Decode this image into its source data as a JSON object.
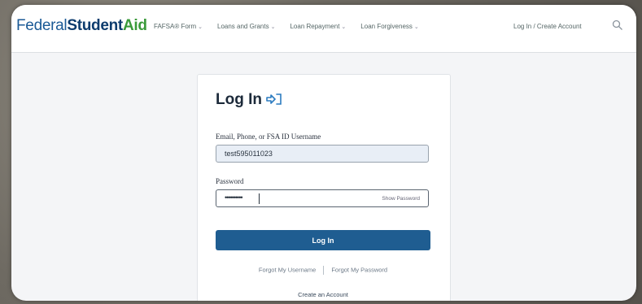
{
  "header": {
    "logo": {
      "part1": "Federal",
      "part2": "Student",
      "part3": "Aid"
    },
    "nav": [
      {
        "label": "FAFSA® Form"
      },
      {
        "label": "Loans and Grants"
      },
      {
        "label": "Loan Repayment"
      },
      {
        "label": "Loan Forgiveness"
      }
    ],
    "auth_link": "Log In / Create Account"
  },
  "login": {
    "title": "Log In",
    "username_label": "Email, Phone, or FSA ID Username",
    "username_value": "test595011023",
    "password_label": "Password",
    "password_value": "••••••••••",
    "show_password": "Show Password",
    "submit": "Log In",
    "forgot_username": "Forgot My Username",
    "forgot_password": "Forgot My Password",
    "create_account": "Create an Account"
  },
  "icons": {
    "login_icon": "sign-in-icon",
    "search_icon": "search-icon",
    "chevron": "chevron-down-icon"
  },
  "colors": {
    "brand_blue": "#1f5d91",
    "logo_green": "#3a9a3a",
    "input_fill": "#e8eef6"
  }
}
